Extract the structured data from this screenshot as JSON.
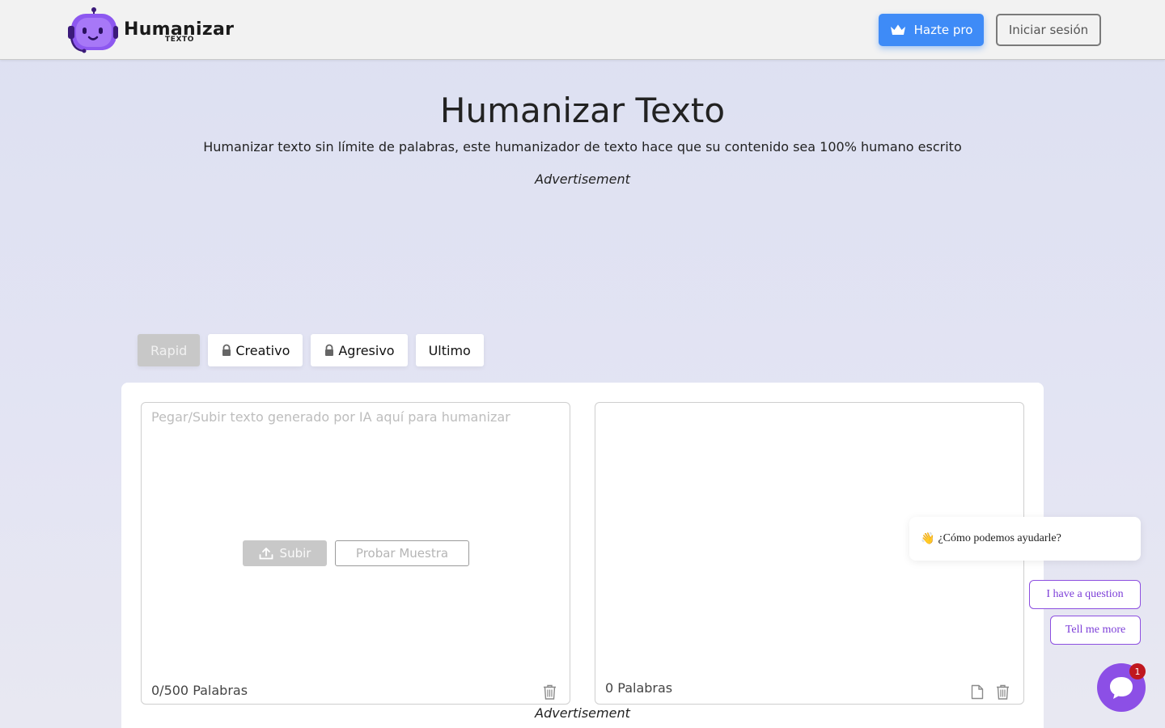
{
  "header": {
    "logo_name": "Humanizar",
    "logo_sub": "TEXTO",
    "pro_button": "Hazte pro",
    "login_button": "Iniciar sesión"
  },
  "hero": {
    "title": "Humanizar Texto",
    "subtitle": "Humanizar texto sin límite de palabras, este humanizador de texto hace que su contenido sea 100% humano escrito",
    "ad_top": "Advertisement",
    "ad_bottom": "Advertisement"
  },
  "modes": [
    {
      "label": "Rapid",
      "active": true,
      "locked": false
    },
    {
      "label": "Creativo",
      "active": false,
      "locked": true
    },
    {
      "label": "Agresivo",
      "active": false,
      "locked": true
    },
    {
      "label": "Ultimo",
      "active": false,
      "locked": false
    }
  ],
  "input_panel": {
    "placeholder": "Pegar/Subir texto generado por IA aquí para humanizar",
    "upload_label": "Subir",
    "sample_label": "Probar Muestra",
    "word_count": "0/500 Palabras"
  },
  "output_panel": {
    "word_count": "0 Palabras"
  },
  "chat": {
    "greeting_emoji": "👋",
    "greeting": "¿Cómo podemos ayudarle?",
    "option_1": "I have a question",
    "option_2": "Tell me more",
    "badge": "1"
  },
  "colors": {
    "accent_blue": "#3e8bf7",
    "brand_purple": "#8c4fe6",
    "badge_red": "#c0171f"
  }
}
